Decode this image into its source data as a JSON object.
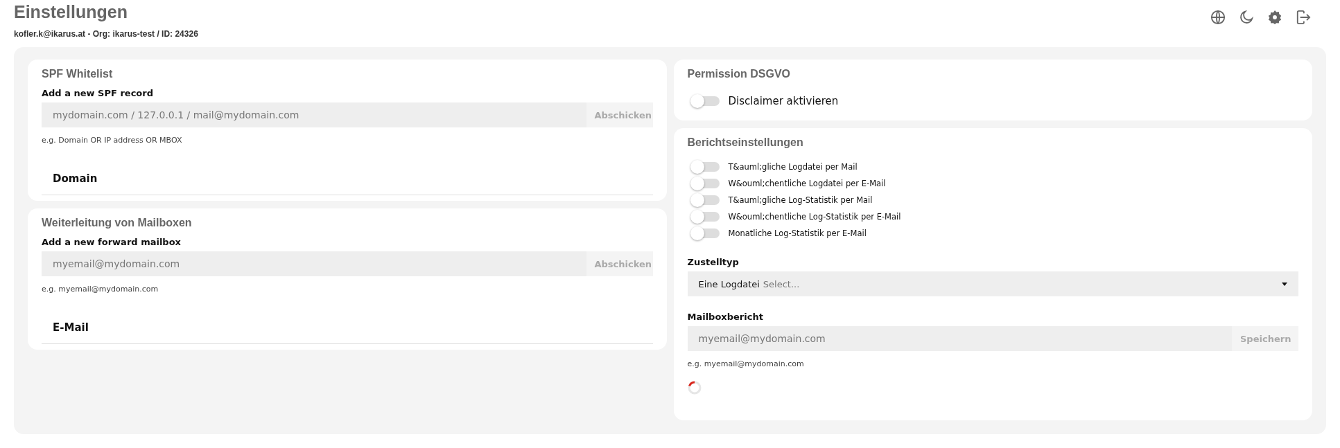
{
  "header": {
    "title": "Einstellungen",
    "subtitle": "kofler.k@ikarus.at - Org: ikarus-test / ID: 24326"
  },
  "spf_whitelist": {
    "title": "SPF Whitelist",
    "label": "Add a new SPF record",
    "field": {
      "placeholder": "mydomain.com / 127.0.0.1 / mail@mydomain.com"
    },
    "button": "Abschicken",
    "hint": "e.g. Domain OR IP address OR MBOX",
    "table": {
      "columns": [
        "Domain"
      ]
    }
  },
  "mailbox_forwarding": {
    "title": "Weiterleitung von Mailboxen",
    "label": "Add a new forward mailbox",
    "field": {
      "placeholder": "myemail@mydomain.com"
    },
    "button": "Abschicken",
    "hint": "e.g. myemail@mydomain.com",
    "table": {
      "columns": [
        "E-Mail"
      ]
    }
  },
  "permission": {
    "title": "Permission DSGVO",
    "toggles": [
      {
        "label": "Disclaimer aktivieren",
        "on": false
      }
    ]
  },
  "report_settings": {
    "title": "Berichtseinstellungen",
    "toggles": [
      {
        "label": "T&auml;gliche Logdatei per Mail",
        "on": false
      },
      {
        "label": "W&ouml;chentliche Logdatei per E-Mail",
        "on": false
      },
      {
        "label": "T&auml;gliche Log-Statistik per Mail",
        "on": false
      },
      {
        "label": "W&ouml;chentliche Log-Statistik per E-Mail",
        "on": false
      },
      {
        "label": "Monatliche Log-Statistik per E-Mail",
        "on": false
      }
    ],
    "delivery_type": {
      "label": "Zustelltyp",
      "value": "Eine Logdatei",
      "placeholder": "Select..."
    },
    "mailbox_report": {
      "label": "Mailboxbericht",
      "field": {
        "placeholder": "myemail@mydomain.com"
      },
      "button": "Speichern",
      "hint": "e.g. myemail@mydomain.com"
    }
  }
}
